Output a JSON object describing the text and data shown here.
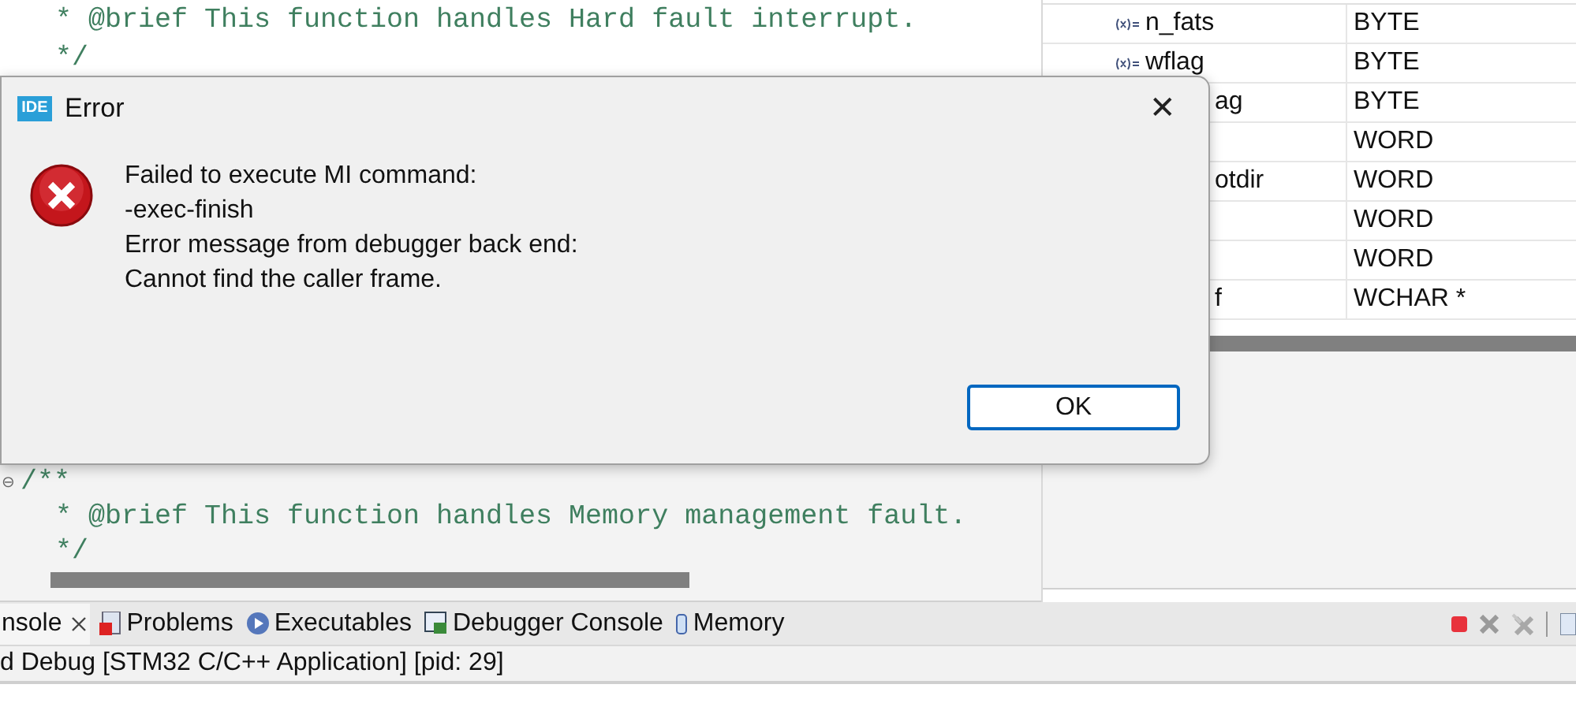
{
  "editor": {
    "lines_top": [
      {
        "text": "  * @brief This function handles Hard fault interrupt."
      },
      {
        "text": "  */"
      }
    ],
    "fold_marker": "⊖",
    "lines_bottom": [
      {
        "text": "/**"
      },
      {
        "text": "  * @brief This function handles Memory management fault."
      },
      {
        "text": "  */"
      }
    ]
  },
  "variables": {
    "rows": [
      {
        "name": "n_fats",
        "type": "BYTE",
        "icon": true
      },
      {
        "name": "wflag",
        "type": "BYTE",
        "icon": true
      },
      {
        "name": "ag",
        "type": "BYTE",
        "icon": false
      },
      {
        "type": "WORD",
        "icon": false
      },
      {
        "name": "otdir",
        "type": "WORD",
        "icon": false
      },
      {
        "type": "WORD",
        "icon": false
      },
      {
        "type": "WORD",
        "icon": false
      },
      {
        "name": "f",
        "type": "WCHAR *",
        "icon": false
      }
    ]
  },
  "bottom_panel": {
    "tabs": [
      {
        "label": "nsole",
        "selected": true,
        "closable": true
      },
      {
        "label": "Problems",
        "selected": false
      },
      {
        "label": "Executables",
        "selected": false
      },
      {
        "label": "Debugger Console",
        "selected": false
      },
      {
        "label": "Memory",
        "selected": false
      }
    ],
    "console_title": "d Debug [STM32 C/C++ Application]  [pid: 29]"
  },
  "dialog": {
    "app_badge": "IDE",
    "title": "Error",
    "close": "✕",
    "message": [
      "Failed to execute MI command:",
      "-exec-finish",
      "Error message from debugger back end:",
      "Cannot find the caller frame."
    ],
    "buttons": [
      {
        "label": "OK",
        "default": true
      }
    ]
  }
}
